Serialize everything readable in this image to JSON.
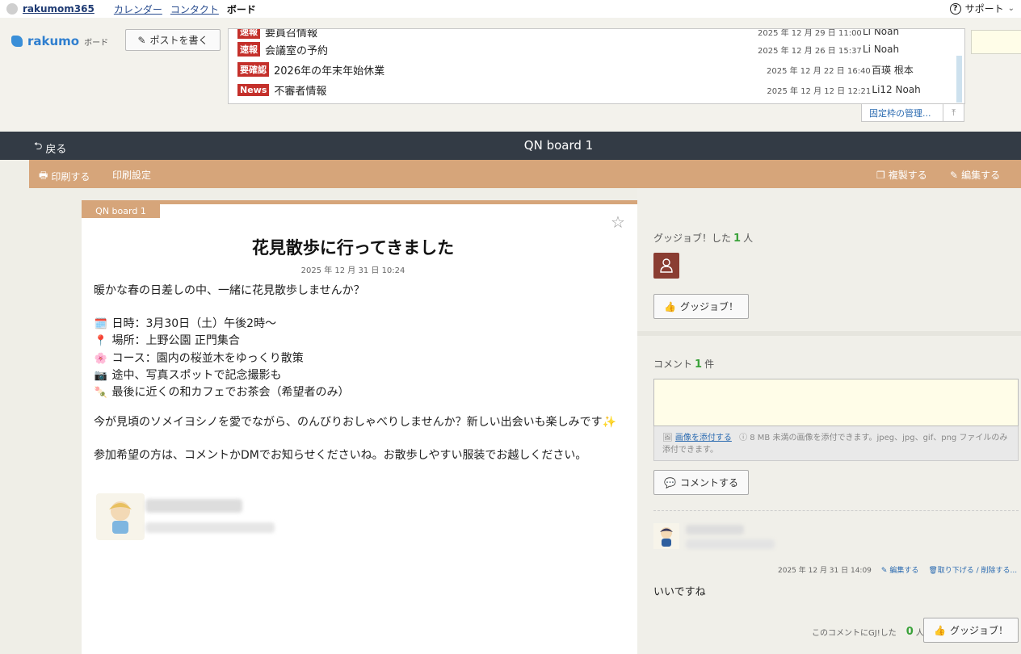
{
  "topbar": {
    "brand_link": "rakumom365",
    "nav": [
      "カレンダー",
      "コンタクト"
    ],
    "current": "ボード",
    "support": "サポート"
  },
  "header": {
    "brand_name": "rakumo",
    "brand_sub": "ボード",
    "post_button": "ポストを書く",
    "pinned": [
      {
        "tag": "速報",
        "title": "要員召情報",
        "date": "2025 年 12 月 29 日 11:00",
        "user": "Li Noah"
      },
      {
        "tag": "速報",
        "title": "会議室の予約",
        "date": "2025 年 12 月 26 日 15:37",
        "user": "Li Noah"
      },
      {
        "tag": "要確認",
        "title": "2026年の年末年始休業",
        "date": "2025 年 12 月 22 日 16:40",
        "user": "百瑛 根本"
      },
      {
        "tag": "News",
        "title": "不審者情報",
        "date": "2025 年 12 月 12 日 12:21",
        "user": "Li12 Noah"
      }
    ],
    "manage_link": "固定枠の管理..."
  },
  "darkbar": {
    "back_label": "戻る",
    "board_name": "QN board 1"
  },
  "toolbar": {
    "print": "印刷する",
    "print_settings": "印刷設定",
    "duplicate": "複製する",
    "edit": "編集する"
  },
  "post": {
    "board_tag": "QN board 1",
    "title": "花見散歩に行ってきました",
    "date": "2025 年 12 月 31 日 10:24",
    "intro": "暖かな春の日差しの中、一緒に花見散歩しませんか？",
    "details": [
      {
        "emoji": "🗓️",
        "text": "日時：3月30日（土）午後2時～"
      },
      {
        "emoji": "📍",
        "text": "場所：上野公園 正門集合"
      },
      {
        "emoji": "🌸",
        "text": "コース：園内の桜並木をゆっくり散策"
      },
      {
        "emoji": "📷",
        "text": "途中、写真スポットで記念撮影も"
      },
      {
        "emoji": "🍡",
        "text": "最後に近くの和カフェでお茶会（希望者のみ）"
      }
    ],
    "para1": "今が見頃のソメイヨシノを愛でながら、のんびりおしゃべりしませんか？新しい出会いも楽しみです✨",
    "para2": "参加希望の方は、コメントかDMでお知らせくださいね。お散歩しやすい服装でお越しください。"
  },
  "goodjob": {
    "label": "グッジョブ！した",
    "count": "1",
    "unit": "人",
    "button": "グッジョブ！"
  },
  "comments": {
    "label": "コメント",
    "count": "1",
    "unit": "件",
    "attach_link": "画像を添付する",
    "attach_note": "8 MB 未満の画像を添付できます。jpeg、jpg、gif、png ファイルのみ添付できます。",
    "submit": "コメントする",
    "items": [
      {
        "date": "2025 年 12 月 31 日 14:09",
        "edit": "編集する",
        "withdraw": "取り下げる / 削除する...",
        "text": "いいですね",
        "gj_label": "このコメントにGJ!した",
        "gj_count": "0",
        "gj_unit": "人",
        "gj_button": "グッジョブ！"
      }
    ]
  }
}
